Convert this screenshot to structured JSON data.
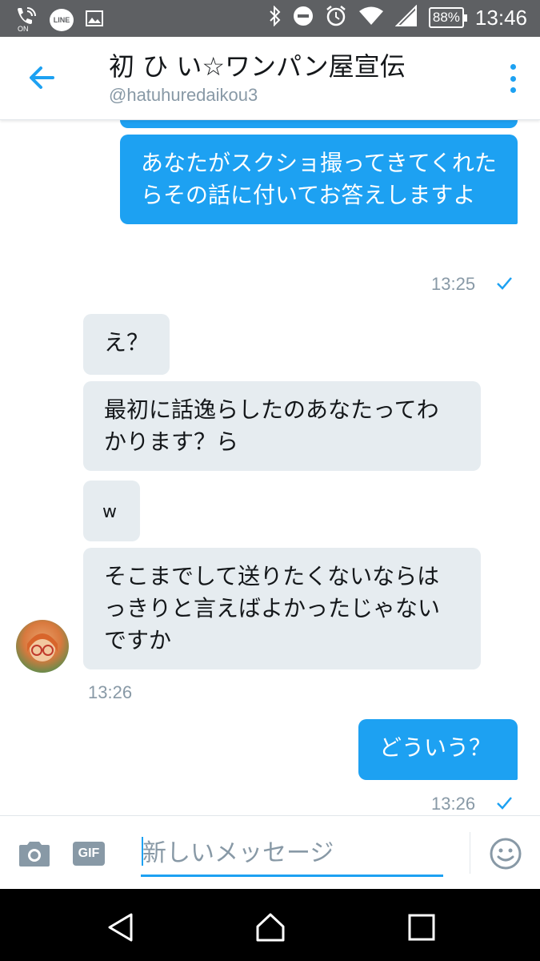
{
  "status_bar": {
    "time": "13:46",
    "battery": "88%",
    "left_icons": [
      "wifi-calling-icon",
      "line-icon",
      "image-icon"
    ],
    "line_label": "LINE",
    "on_label": "ON",
    "right_icons": [
      "bluetooth-icon",
      "dnd-icon",
      "alarm-icon",
      "wifi-icon",
      "signal-icon",
      "battery-icon"
    ]
  },
  "header": {
    "title": "初 ひ い☆ワンパン屋宣伝",
    "handle": "@hatuhuredaikou3"
  },
  "messages": [
    {
      "type": "sent",
      "text": "あなたがスクショ撮ってきてくれたらその話に付いてお答えしますよ"
    },
    {
      "type": "sent_time",
      "text": "13:25"
    },
    {
      "type": "recv",
      "text": "え？"
    },
    {
      "type": "recv",
      "text": "最初に話逸らしたのあなたってわかります？ら"
    },
    {
      "type": "recv",
      "text": "w"
    },
    {
      "type": "recv",
      "text": "そこまでして送りたくないならはっきりと言えばよかったじゃないですか"
    },
    {
      "type": "recv_time",
      "text": "13:26"
    },
    {
      "type": "sent",
      "text": "どういう？"
    },
    {
      "type": "sent_time",
      "text": "13:26"
    }
  ],
  "composer": {
    "placeholder": "新しいメッセージ",
    "gif_label": "GIF"
  },
  "colors": {
    "accent": "#1da1f2",
    "received_bubble": "#e6ecf0",
    "timestamp": "#8899a6",
    "status_bar": "#5e6063"
  }
}
